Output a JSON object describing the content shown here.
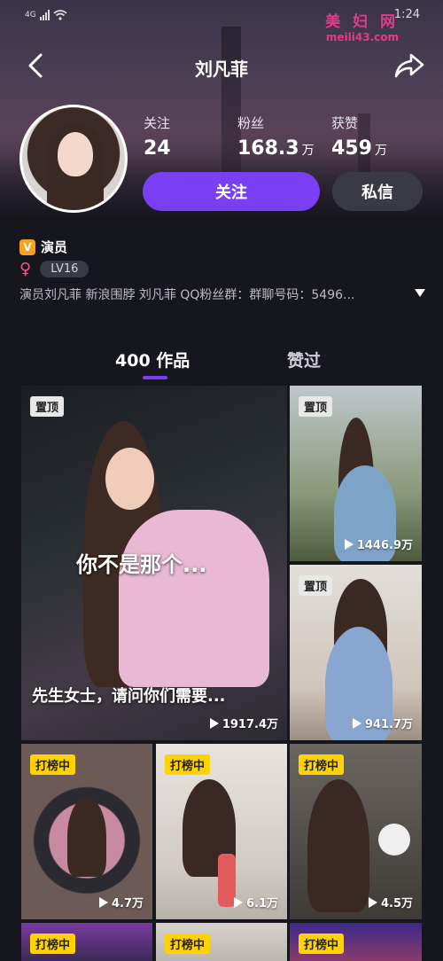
{
  "status": {
    "network": "4G",
    "time": "1:24"
  },
  "watermark": {
    "line1": "美 妇 网",
    "line2": "meili43.com"
  },
  "nav": {
    "title": "刘凡菲"
  },
  "stats": [
    {
      "label": "关注",
      "value": "24",
      "unit": ""
    },
    {
      "label": "粉丝",
      "value": "168.3",
      "unit": "万"
    },
    {
      "label": "获赞",
      "value": "459",
      "unit": "万"
    }
  ],
  "actions": {
    "follow_label": "关注",
    "message_label": "私信"
  },
  "profile": {
    "verify_badge": "V",
    "role": "演员",
    "gender_icon": "♀",
    "level": "LV16",
    "bio": "演员刘凡菲 新浪围脖 刘凡菲 QQ粉丝群：群聊号码：5496..."
  },
  "tabs": {
    "works_label": "400 作品",
    "liked_label": "赞过"
  },
  "videos": [
    {
      "badge": "置顶",
      "badge_type": "pin",
      "views": "1917.4万",
      "subtitle_top": "你不是那个...",
      "subtitle_bottom": "先生女士，请问你们需要..."
    },
    {
      "badge": "置顶",
      "badge_type": "pin",
      "views": "1446.9万"
    },
    {
      "badge": "置顶",
      "badge_type": "pin",
      "views": "941.7万"
    },
    {
      "badge": "打榜中",
      "badge_type": "rank",
      "views": "4.7万"
    },
    {
      "badge": "打榜中",
      "badge_type": "rank",
      "views": "6.1万"
    },
    {
      "badge": "打榜中",
      "badge_type": "rank",
      "views": "4.5万"
    },
    {
      "badge": "打榜中",
      "badge_type": "rank",
      "views": ""
    },
    {
      "badge": "打榜中",
      "badge_type": "rank",
      "views": ""
    },
    {
      "badge": "打榜中",
      "badge_type": "rank",
      "views": ""
    }
  ],
  "colors": {
    "accent": "#7b3ff2",
    "rank_badge": "#ffd200",
    "background": "#16161e"
  }
}
